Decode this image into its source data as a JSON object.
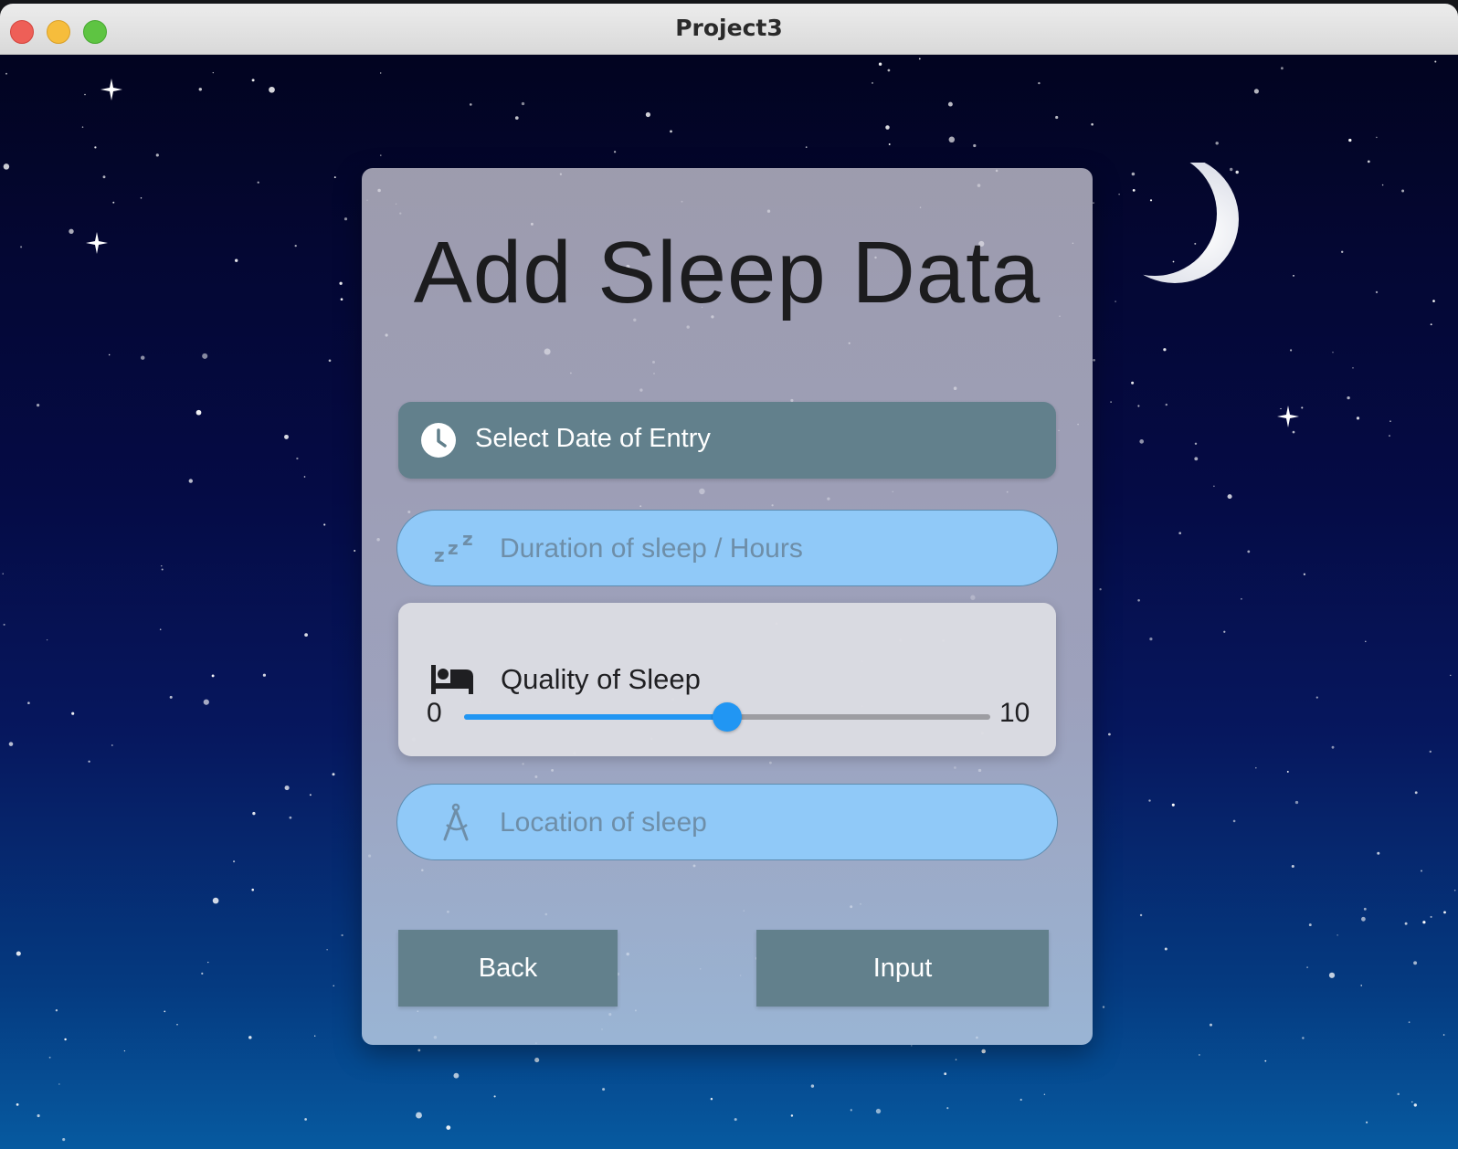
{
  "window": {
    "title": "Project3"
  },
  "form": {
    "heading": "Add Sleep Data",
    "date_button_label": "Select Date of Entry",
    "duration": {
      "placeholder": "Duration of sleep / Hours",
      "value": "",
      "icon": "zzz-icon"
    },
    "quality": {
      "label": "Quality of Sleep",
      "min_label": "0",
      "max_label": "10",
      "value_fraction": 0.5,
      "icon": "bed-icon"
    },
    "location": {
      "placeholder": "Location of sleep",
      "value": "",
      "icon": "compass-icon"
    },
    "back_label": "Back",
    "input_label": "Input"
  },
  "colors": {
    "button_bg": "#62808c",
    "field_bg": "#90c9f8",
    "slider_active": "#2196f3",
    "slider_inactive": "#9d9da2"
  }
}
